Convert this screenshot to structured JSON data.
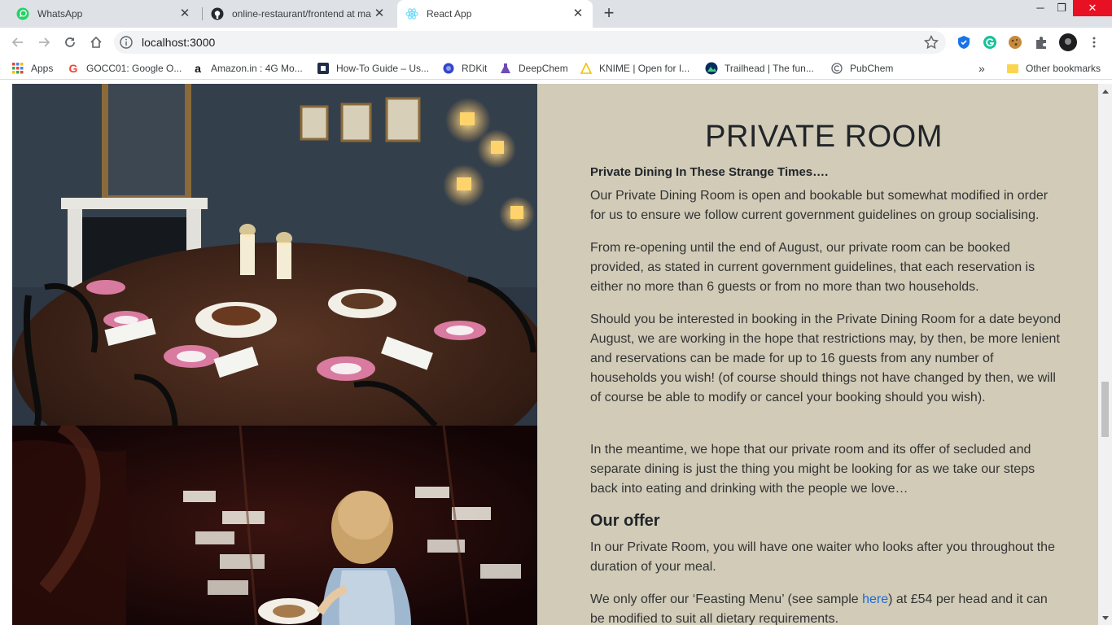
{
  "tabs": [
    {
      "title": "WhatsApp",
      "icon": "whatsapp-icon"
    },
    {
      "title": "online-restaurant/frontend at ma",
      "icon": "github-icon"
    },
    {
      "title": "React App",
      "icon": "react-icon",
      "active": true
    }
  ],
  "toolbar": {
    "url": "localhost:3000"
  },
  "bookmarks": [
    {
      "label": "Apps",
      "icon": "apps-grid-icon"
    },
    {
      "label": "GOCC01: Google O...",
      "icon": "google-icon"
    },
    {
      "label": "Amazon.in : 4G Mo...",
      "icon": "amazon-icon"
    },
    {
      "label": "How-To Guide – Us...",
      "icon": "guide-icon"
    },
    {
      "label": "RDKit",
      "icon": "rdkit-icon"
    },
    {
      "label": "DeepChem",
      "icon": "deepchem-icon"
    },
    {
      "label": "KNIME | Open for I...",
      "icon": "knime-icon"
    },
    {
      "label": "Trailhead | The fun...",
      "icon": "trailhead-icon"
    },
    {
      "label": "PubChem",
      "icon": "pubchem-icon"
    }
  ],
  "other_bookmarks": "Other bookmarks",
  "page": {
    "heading": "PRIVATE ROOM",
    "subheading": "Private Dining In These Strange Times….",
    "paragraphs": [
      "Our Private Dining Room is open and bookable but somewhat modified in order for us to ensure we follow current government guidelines on group socialising.",
      "From re-opening until the end of August, our private room can be booked provided, as stated in current government guidelines, that each reservation is either no more than 6 guests or from no more than two households.",
      "Should you be interested in booking in the Private Dining Room for a date beyond August, we are working in the hope that restrictions may, by then, be more lenient and reservations can be made for up to 16 guests from any number of households you wish! (of course should things not have changed by then, we will of course be able to modify or cancel your booking should you wish).",
      "In the meantime, we hope that our private room and its offer of secluded and separate dining is just the thing you might be looking for as we take our steps back into eating and drinking with the people we love…"
    ],
    "offer_title": "Our offer",
    "offer_para": "In our Private Room, you will have one waiter who looks after you throughout the duration of your meal.",
    "feast_before": "We only offer our ‘Feasting Menu’ (see sample ",
    "feast_link": "here",
    "feast_after": ") at £54 per head and it can be modified to suit all dietary requirements."
  },
  "colors": {
    "page_background": "#d1cbb8",
    "link": "#1a6ad6",
    "close_button": "#e81123"
  }
}
